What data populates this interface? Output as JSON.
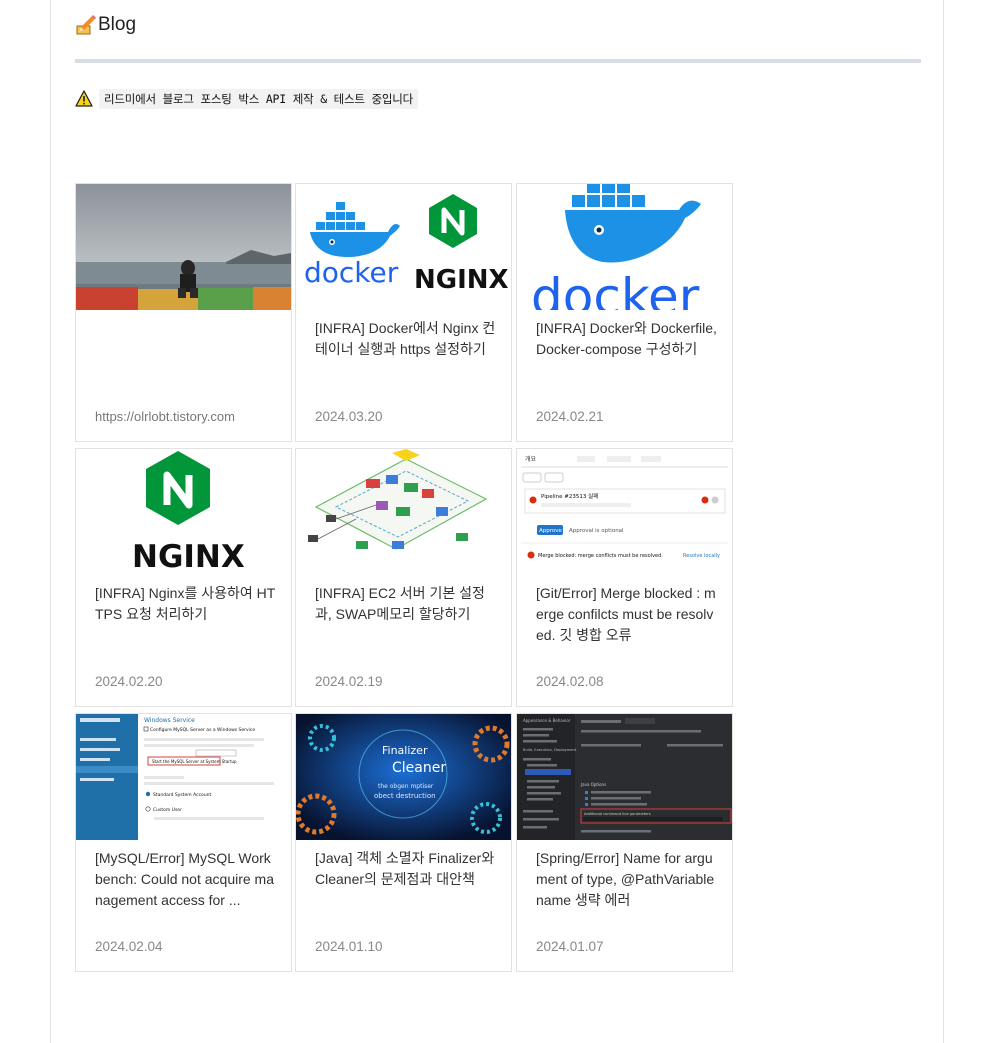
{
  "header": {
    "title": "Blog"
  },
  "notice": {
    "text": "리드미에서 블로그 포스팅 박스 API 제작 & 테스트 중입니다"
  },
  "profile_card": {
    "url": "https://olrlobt.tistory.com"
  },
  "posts": [
    {
      "title": "[INFRA] Docker에서 Nginx 컨테이너 실행과 https 설정하기",
      "date": "2024.03.20",
      "thumb_text": [
        "docker",
        "NGINX"
      ]
    },
    {
      "title": "[INFRA] Docker와 Dockerfile, Docker-compose 구성하기",
      "date": "2024.02.21",
      "thumb_text": [
        "docker"
      ]
    },
    {
      "title": "[INFRA] Nginx를 사용하여 HTTPS 요청 처리하기",
      "date": "2024.02.20",
      "thumb_text": [
        "NGINX"
      ]
    },
    {
      "title": "[INFRA] EC2 서버 기본 설정과, SWAP메모리 할당하기",
      "date": "2024.02.19",
      "thumb_text": []
    },
    {
      "title": "[Git/Error] Merge blocked : merge confilcts must be resolved. 깃 병합 오류",
      "date": "2024.02.08",
      "thumb_text": [
        "개요",
        "Pipeline #23513 실패",
        "Approve",
        "Approval is optional",
        "Merge blocked: merge conflicts must be resolved.",
        "Resolve locally"
      ]
    },
    {
      "title": "[MySQL/Error] MySQL Workbench: Could not acquire management access for ...",
      "date": "2024.02.04",
      "thumb_text": [
        "Windows Service",
        "Configure MySQL Server as a Windows Service",
        "Start the MySQL Server at System Startup",
        "Standard System Account",
        "Custom User"
      ]
    },
    {
      "title": "[Java] 객체 소멸자 Finalizer와 Cleaner의 문제점과 대안책",
      "date": "2024.01.10",
      "thumb_text": [
        "Finalizer",
        "Cleaner",
        "the obgen mptiser",
        "obect destruction"
      ]
    },
    {
      "title": "[Spring/Error] Name for argument of type, @PathVariable name 생략 에러",
      "date": "2024.01.07",
      "thumb_text": [
        "Appearance & Behavior",
        "Build, Execution, Deployment",
        "Java Options",
        "Additional command line parameters"
      ]
    }
  ],
  "colors": {
    "docker_blue": "#1d91e6",
    "nginx_green": "#009639",
    "divider": "#d8dde4",
    "date_gray": "#888888"
  }
}
